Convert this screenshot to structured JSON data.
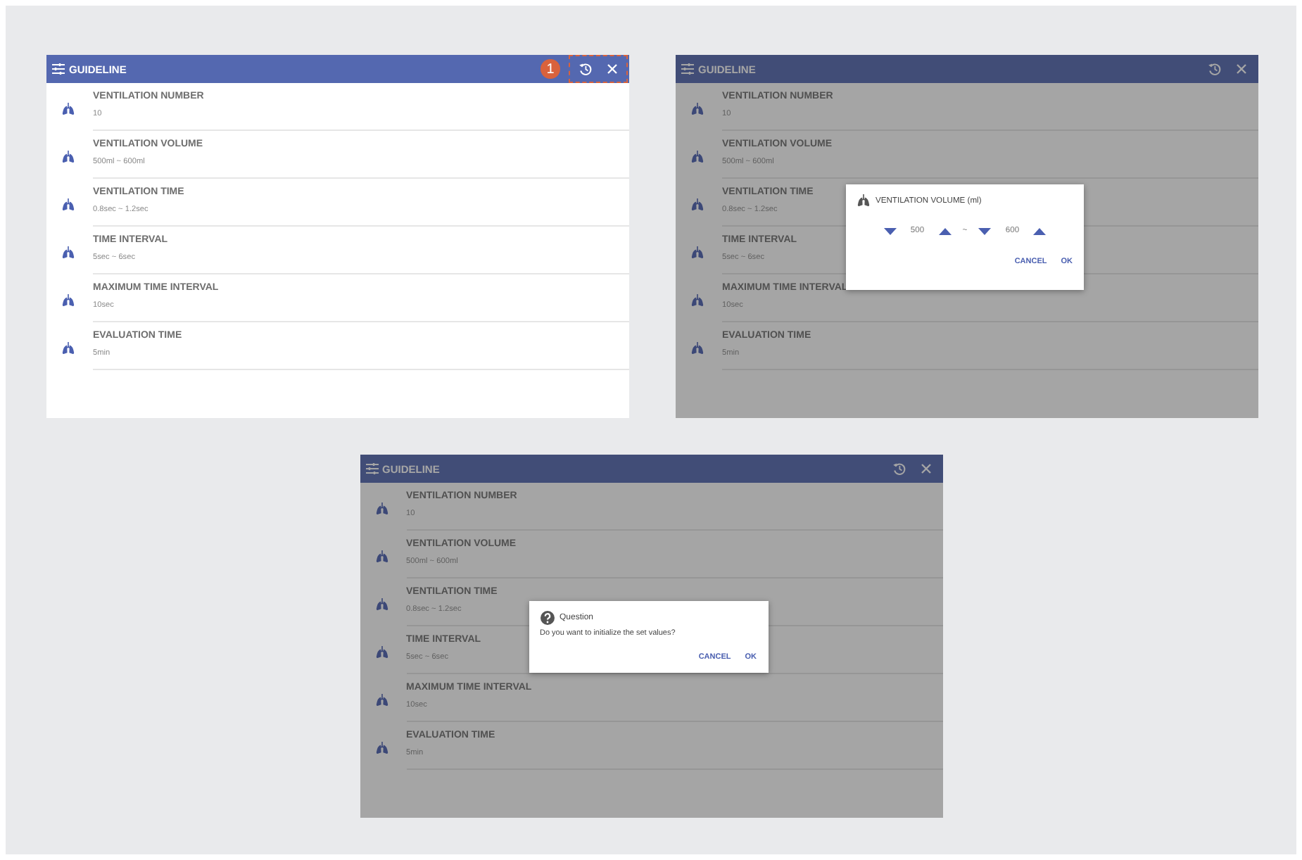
{
  "screens": [
    {
      "title": "GUIDELINE",
      "dimmed": false,
      "callout": "1",
      "items": [
        {
          "label": "VENTILATION NUMBER",
          "value": "10"
        },
        {
          "label": "VENTILATION VOLUME",
          "value": "500ml ~ 600ml"
        },
        {
          "label": "VENTILATION TIME",
          "value": "0.8sec ~ 1.2sec"
        },
        {
          "label": "TIME INTERVAL",
          "value": "5sec ~ 6sec"
        },
        {
          "label": "MAXIMUM TIME INTERVAL",
          "value": "10sec"
        },
        {
          "label": "EVALUATION TIME",
          "value": "5min"
        }
      ]
    },
    {
      "title": "GUIDELINE",
      "dimmed": true,
      "items": [
        {
          "label": "VENTILATION NUMBER",
          "value": "10"
        },
        {
          "label": "VENTILATION VOLUME",
          "value": "500ml ~ 600ml"
        },
        {
          "label": "VENTILATION TIME",
          "value": "0.8sec ~ 1.2sec"
        },
        {
          "label": "TIME INTERVAL",
          "value": "5sec ~ 6sec"
        },
        {
          "label": "MAXIMUM TIME INTERVAL",
          "value": "10sec"
        },
        {
          "label": "EVALUATION TIME",
          "value": "5min"
        }
      ],
      "dialog": {
        "kind": "range",
        "title": "VENTILATION VOLUME (ml)",
        "min": "500",
        "separator": "~",
        "max": "600",
        "buttons": [
          "CANCEL",
          "OK"
        ]
      }
    },
    {
      "title": "GUIDELINE",
      "dimmed": true,
      "items": [
        {
          "label": "VENTILATION NUMBER",
          "value": "10"
        },
        {
          "label": "VENTILATION VOLUME",
          "value": "500ml ~ 600ml"
        },
        {
          "label": "VENTILATION TIME",
          "value": "0.8sec ~ 1.2sec"
        },
        {
          "label": "TIME INTERVAL",
          "value": "5sec ~ 6sec"
        },
        {
          "label": "MAXIMUM TIME INTERVAL",
          "value": "10sec"
        },
        {
          "label": "EVALUATION TIME",
          "value": "5min"
        }
      ],
      "dialog": {
        "kind": "question",
        "title": "Question",
        "message": "Do you want to initialize the set values?",
        "buttons": [
          "CANCEL",
          "OK"
        ]
      }
    }
  ]
}
